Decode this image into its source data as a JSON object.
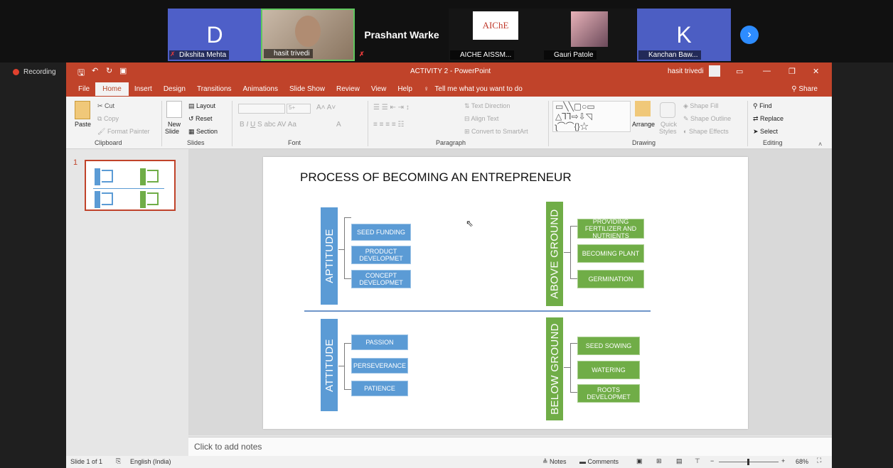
{
  "participants": [
    {
      "initial": "D",
      "name": "Dikshita Mehta"
    },
    {
      "initial": "",
      "name": "hasit trivedi"
    },
    {
      "initial": "",
      "name": "Prashant Warke"
    },
    {
      "initial": "",
      "name": "AICHE AISSM..."
    },
    {
      "initial": "",
      "name": "Gauri Patole"
    },
    {
      "initial": "K",
      "name": "Kanchan Baw..."
    }
  ],
  "aiche_logo_text": "AIChE",
  "recording": "Recording",
  "window": {
    "title": "ACTIVITY 2 - PowerPoint",
    "user": "hasit trivedi",
    "share": "Share"
  },
  "tabs": [
    "File",
    "Home",
    "Insert",
    "Design",
    "Transitions",
    "Animations",
    "Slide Show",
    "Review",
    "View",
    "Help"
  ],
  "tell_me": "Tell me what you want to do",
  "ribbon": {
    "clipboard": {
      "label": "Clipboard",
      "paste": "Paste",
      "cut": "Cut",
      "copy": "Copy",
      "format_painter": "Format Painter"
    },
    "slides": {
      "label": "Slides",
      "new_slide": "New",
      "new_slide_2": "Slide",
      "layout": "Layout",
      "reset": "Reset",
      "section": "Section"
    },
    "font": {
      "label": "Font",
      "size": "5+"
    },
    "paragraph": {
      "label": "Paragraph",
      "text_direction": "Text Direction",
      "align_text": "Align Text",
      "smartart": "Convert to SmartArt"
    },
    "drawing": {
      "label": "Drawing",
      "arrange": "Arrange",
      "quick_styles": "Quick",
      "quick_styles_2": "Styles",
      "shape_fill": "Shape Fill",
      "shape_outline": "Shape Outline",
      "shape_effects": "Shape Effects"
    },
    "editing": {
      "label": "Editing",
      "find": "Find",
      "replace": "Replace",
      "select": "Select"
    }
  },
  "thumb_number": "1",
  "slide": {
    "title": "PROCESS OF BECOMING AN ENTREPRENEUR",
    "aptitude": {
      "label": "APTITUDE",
      "items": [
        "SEED FUNDING",
        "PRODUCT DEVELOPMET",
        "CONCEPT DEVELOPMET"
      ]
    },
    "attitude": {
      "label": "ATTITUDE",
      "items": [
        "PASSION",
        "PERSEVERANCE",
        "PATIENCE"
      ]
    },
    "above": {
      "label": "ABOVE GROUND",
      "items": [
        "PROVIDING FERTILIZER AND NUTRIENTS",
        "BECOMING PLANT",
        "GERMINATION"
      ]
    },
    "below": {
      "label": "BELOW GROUND",
      "items": [
        "SEED SOWING",
        "WATERING",
        "ROOTS DEVELOPMET"
      ]
    }
  },
  "notes_placeholder": "Click to add notes",
  "status": {
    "slide": "Slide 1 of 1",
    "language": "English (India)",
    "notes": "Notes",
    "comments": "Comments",
    "zoom": "68%"
  },
  "colors": {
    "ppt_red": "#c0432a",
    "blue": "#5b9bd5",
    "green": "#70ad47",
    "zoom_blue": "#2d8cff"
  }
}
